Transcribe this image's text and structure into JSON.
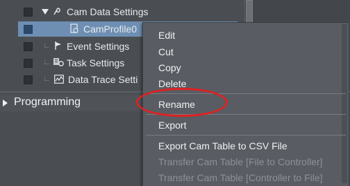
{
  "tree": {
    "items": [
      {
        "label": "Cam Data Settings",
        "icon": "cam-icon"
      },
      {
        "label": "CamProfile0",
        "icon": "cam-profile-icon"
      },
      {
        "label": "Event Settings",
        "icon": "flag-icon"
      },
      {
        "label": "Task Settings",
        "icon": "task-icon"
      },
      {
        "label": "Data Trace Setti",
        "icon": "trace-icon"
      }
    ]
  },
  "section": {
    "label": "Programming"
  },
  "context_menu": {
    "items": [
      {
        "label": "Edit",
        "enabled": true
      },
      {
        "label": "Cut",
        "enabled": true
      },
      {
        "label": "Copy",
        "enabled": true
      },
      {
        "label": "Delete",
        "enabled": true
      },
      {
        "label": "Rename",
        "enabled": true,
        "highlighted": true
      },
      {
        "label": "Export",
        "enabled": true
      },
      {
        "label": "Export Cam Table to CSV File",
        "enabled": true
      },
      {
        "label": "Transfer Cam Table [File to Controller]",
        "enabled": false
      },
      {
        "label": "Transfer Cam Table [Controller to File]",
        "enabled": false
      }
    ]
  },
  "colors": {
    "selection": "#6e8fb3",
    "highlight_oval": "#e02020",
    "menu_bg": "#595d63"
  }
}
